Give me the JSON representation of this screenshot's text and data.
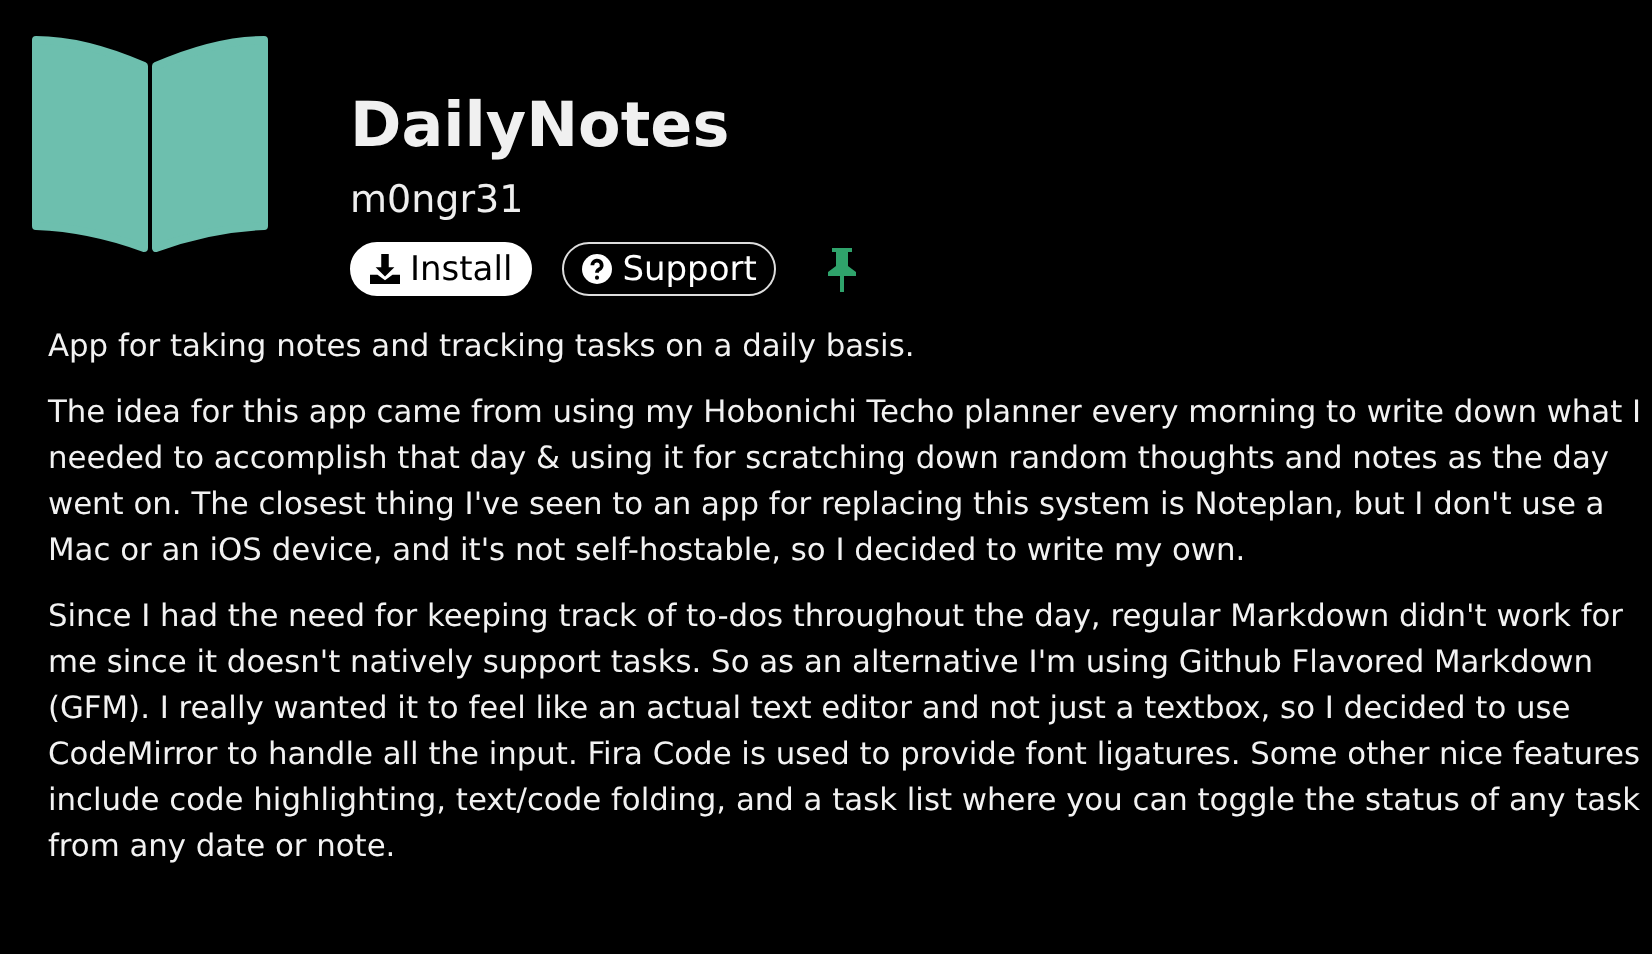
{
  "app": {
    "name": "DailyNotes",
    "author": "m0ngr31"
  },
  "buttons": [
    {
      "kind": "install",
      "label": "Install"
    },
    {
      "kind": "support",
      "label": "Support"
    }
  ],
  "description": [
    "App for taking notes and tracking tasks on a daily basis.",
    "The idea for this app came from using my Hobonichi Techo planner every morning to write down what I needed to accomplish that day & using it for scratching down random thoughts and notes as the day went on. The closest thing I've seen to an app for replacing this system is Noteplan, but I don't use a Mac or an iOS device, and it's not self-hostable, so I decided to write my own.",
    "Since I had the need for keeping track of to-dos throughout the day, regular Markdown didn't work for me since it doesn't natively support tasks. So as an alternative I'm using Github Flavored Markdown (GFM). I really wanted it to feel like an actual text editor and not just a textbox, so I decided to use CodeMirror to handle all the input. Fira Code is used to provide font ligatures. Some other nice features include code highlighting, text/code folding, and a task list where you can toggle the status of any task from any date or note."
  ]
}
